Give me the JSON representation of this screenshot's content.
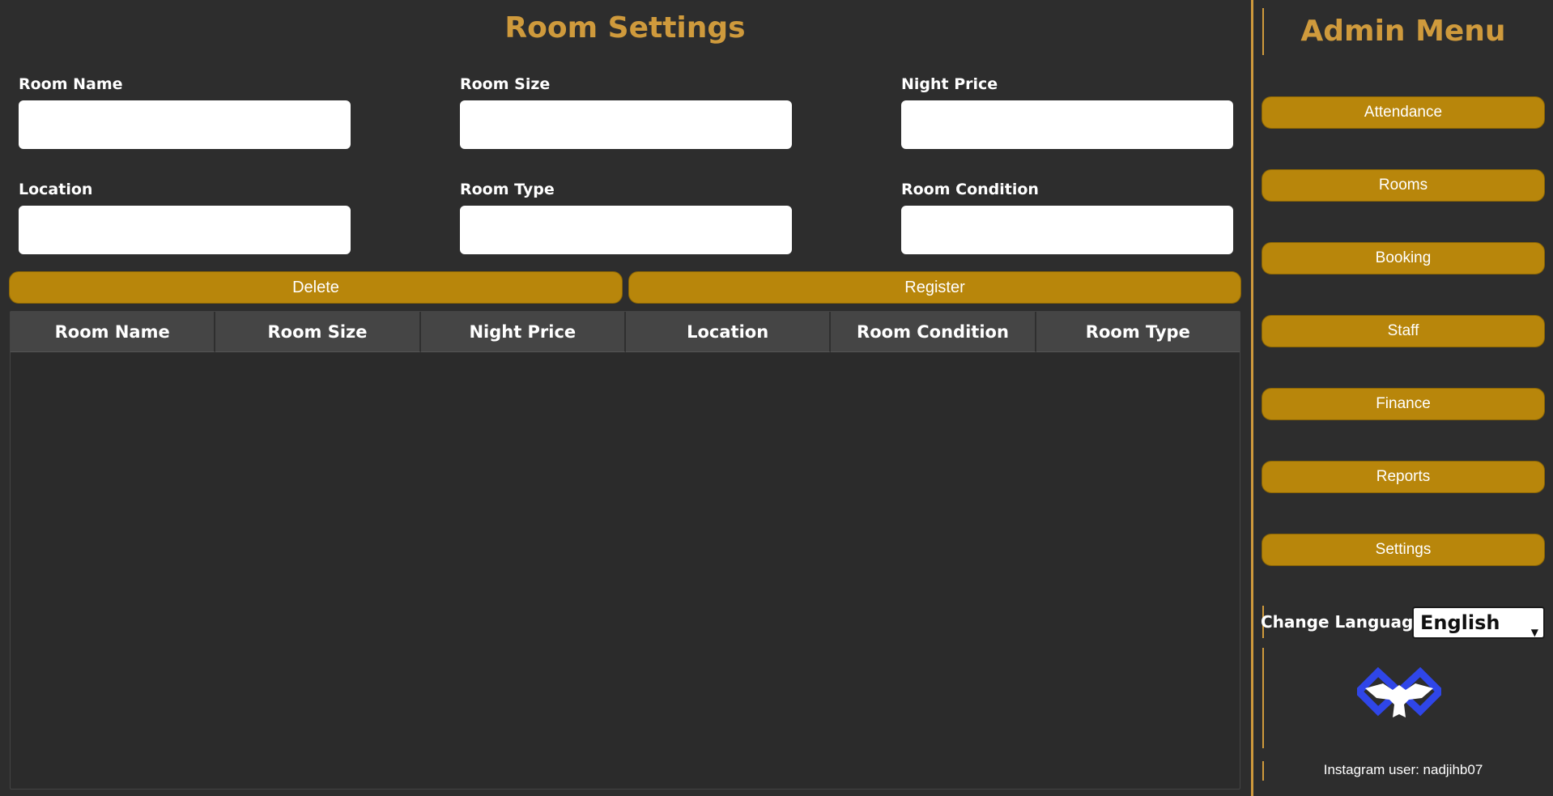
{
  "main": {
    "title": "Room Settings",
    "fields": {
      "room_name": {
        "label": "Room Name",
        "value": ""
      },
      "room_size": {
        "label": "Room Size",
        "value": ""
      },
      "night_price": {
        "label": "Night Price",
        "value": ""
      },
      "location": {
        "label": "Location",
        "value": ""
      },
      "room_type": {
        "label": "Room Type",
        "value": ""
      },
      "room_condition": {
        "label": "Room Condition",
        "value": ""
      }
    },
    "buttons": {
      "delete": "Delete",
      "register": "Register"
    },
    "table": {
      "columns": [
        "Room Name",
        "Room Size",
        "Night Price",
        "Location",
        "Room Condition",
        "Room Type"
      ],
      "rows": []
    }
  },
  "sidebar": {
    "title": "Admin Menu",
    "menu": [
      "Attendance",
      "Rooms",
      "Booking",
      "Staff",
      "Finance",
      "Reports",
      "Settings"
    ],
    "language_label": "Change Language",
    "language_selected": "English",
    "logo_icon": "eagle-logo-icon",
    "instagram": "Instagram user: nadjihb07"
  },
  "colors": {
    "background": "#2d2d2d",
    "accent": "#cf9a3c",
    "button": "#b8860b",
    "table_header": "#454545",
    "logo_blue": "#2f46e8"
  }
}
